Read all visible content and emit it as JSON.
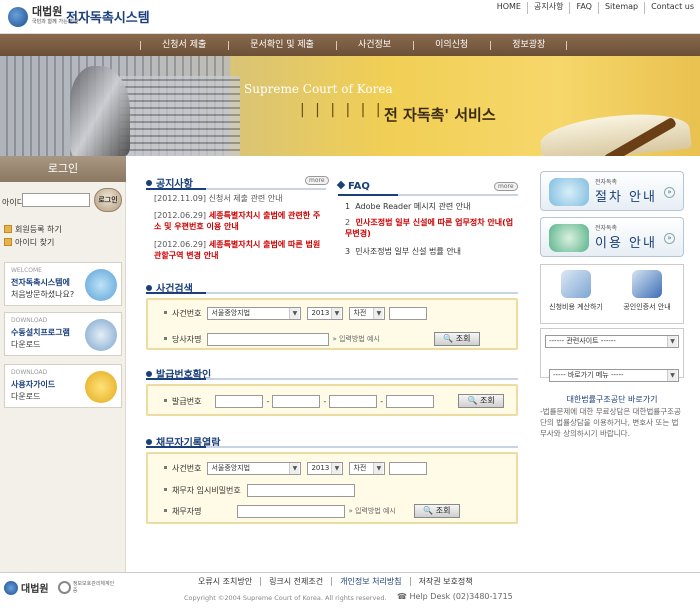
{
  "header": {
    "logo_text": "대법원",
    "logo_sub": "국민과 함께 가는 법원",
    "system_name": "전자독촉시스템",
    "top_links": [
      "HOME",
      "공지사항",
      "FAQ",
      "Sitemap",
      "Contact us"
    ]
  },
  "gnb": [
    "신청서 제출",
    "문서확인 및 제출",
    "사건정보",
    "이의신청",
    "정보광장"
  ],
  "banner": {
    "court": "Supreme Court of Korea",
    "bars": "| | | | | |",
    "service": "전 자독촉' 서비스"
  },
  "login": {
    "title": "로그인",
    "id_label": "아이디",
    "button": "로그인",
    "join": "회원등록 하기",
    "find_id": "아이디 찾기"
  },
  "sideboxes": [
    {
      "kicker": "WELCOME",
      "title": "전자독촉시스템에",
      "sub": "처음방문하셨나요?"
    },
    {
      "kicker": "DOWNLOAD",
      "title": "수동설치프로그램",
      "sub": "다운로드"
    },
    {
      "kicker": "DOWNLOAD",
      "title": "사용자가이드",
      "sub": "다운로드"
    }
  ],
  "notice": {
    "title": "공지사항",
    "more": "more",
    "items": [
      {
        "date": "[2012.11.09]",
        "text": "신청서 제출 관련 안내"
      },
      {
        "date": "[2012.06.29]",
        "text": "세종특별자치시 출범에 관련한 주소 및 우편번호 이용 안내"
      },
      {
        "date": "[2012.06.29]",
        "text": "세종특별자치시 출범에 따른 법원 관할구역 변경 안내"
      }
    ]
  },
  "faq": {
    "title": "FAQ",
    "more": "more",
    "items": [
      {
        "num": "1",
        "text": "Adobe Reader 메시지 관련 안내"
      },
      {
        "num": "2",
        "text": "민사조정법 일부 신설에 따른 업무정차 안내(업무변경)"
      },
      {
        "num": "3",
        "text": "민사조정법 일부 신설 법률 안내"
      }
    ]
  },
  "case_search": {
    "title": "사건검색",
    "case_no_label": "사건번호",
    "court": "서울중앙지법",
    "year": "2013",
    "type": "차전",
    "party_label": "당사자명",
    "guide": "입력방법 예시",
    "button": "조회"
  },
  "issue_check": {
    "title": "발급번호확인",
    "label": "발급번호",
    "sep": "-",
    "button": "조회"
  },
  "debtor": {
    "title": "채무자기록열람",
    "case_no_label": "사건번호",
    "court": "서울중앙지법",
    "year": "2013",
    "type": "차전",
    "pw_label": "채무자 임시비밀번호",
    "name_label": "채무자명",
    "guide": "입력방법 예시",
    "button": "조회"
  },
  "right": {
    "btn1": {
      "small": "전자독촉",
      "big": "절차 안내"
    },
    "btn2": {
      "small": "전자독촉",
      "big": "이용 안내"
    },
    "quick1": "신청비용 계산하기",
    "quick2": "공인인증서 안내",
    "site_select": "------ 관련사이트 ------",
    "shortcut_select": "----- 바로가기 메뉴 -----",
    "legal_title": "대한법률구조공단 바로가기",
    "legal_text": "-법률문제에 대한 무료상담은 대한법률구조공단의 법률상담을 이용하거나, 변호사 또는 법무사와 상의하시기 바랍니다."
  },
  "footer": {
    "logo_text": "대법원",
    "logo2": "정보보호관리체계인증",
    "links": [
      "오류시 조치방안",
      "링크시 전제조건",
      "개인정보 처리방침",
      "저작권 보호정책"
    ],
    "copyright": "Copyright ©2004 Supreme Court of Korea. All rights reserved.",
    "help": "☎ Help Desk (02)3480-1715"
  },
  "colors": {
    "accent": "#1a3f7a",
    "gnb": "#7a5e44",
    "alert": "#cc0000"
  }
}
